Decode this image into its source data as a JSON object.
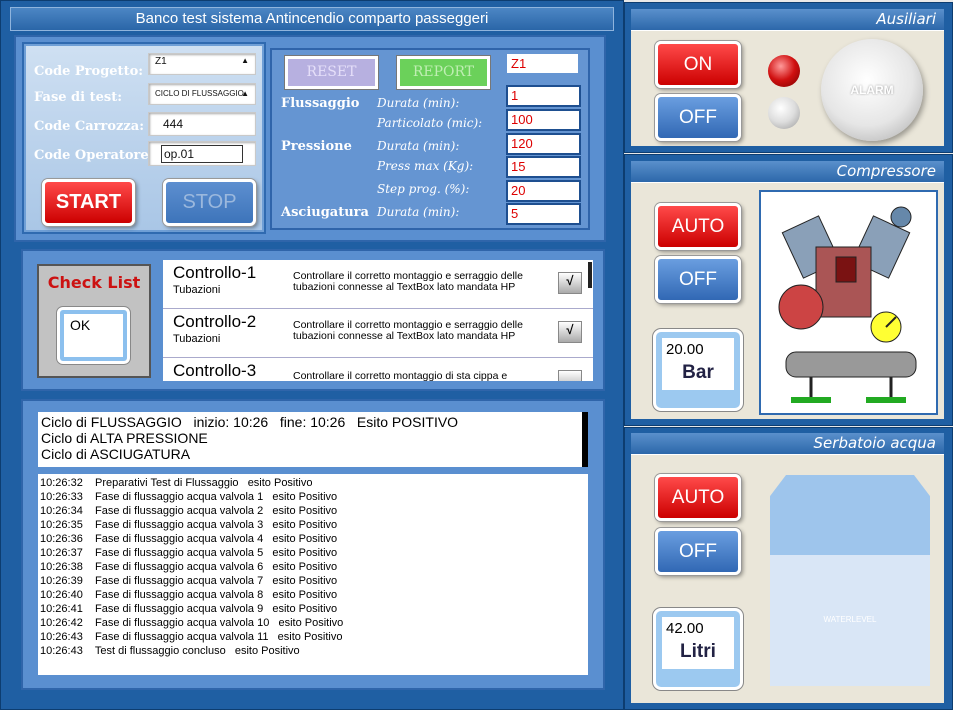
{
  "header": {
    "title": "Banco test sistema Antincendio comparto passeggeri"
  },
  "form": {
    "code_progetto_label": "Code Progetto:",
    "code_progetto_value": "Z1",
    "fase_label": "Fase di test:",
    "fase_value": "CICLO DI FLUSSAGGIO",
    "carrozza_label": "Code Carrozza:",
    "carrozza_value": "444",
    "operatore_label": "Code Operatore:",
    "operatore_value": "op.01",
    "start_label": "START",
    "stop_label": "STOP"
  },
  "params": {
    "reset_label": "RESET",
    "report_label": "REPORT",
    "zone_value": "Z1",
    "flussaggio_label": "Flussaggio",
    "pressione_label": "Pressione",
    "asciugatura_label": "Asciugatura",
    "durata_label": "Durata (min):",
    "particolato_label": "Particolato (mic):",
    "press_max_label": "Press max (Kg):",
    "step_label": "Step prog. (%):",
    "v_fl_durata": "1",
    "v_fl_part": "100",
    "v_pr_durata": "120",
    "v_pr_max": "15",
    "v_pr_step": "20",
    "v_as_durata": "5"
  },
  "checklist": {
    "title": "Check List",
    "ok_label": "OK",
    "items": [
      {
        "title": "Controllo-1",
        "sub": "Tubazioni",
        "desc": "Controllare il corretto montaggio e serraggio delle tubazioni connesse al TextBox lato mandata HP",
        "check": "√"
      },
      {
        "title": "Controllo-2",
        "sub": "Tubazioni",
        "desc": "Controllare il corretto montaggio e serraggio delle tubazioni connesse al TextBox lato mandata HP",
        "check": "√"
      },
      {
        "title": "Controllo-3",
        "sub": "",
        "desc": "Controllare il corretto montaggio di sta cippa e",
        "check": ""
      }
    ]
  },
  "cycles": {
    "line1": "Ciclo di FLUSSAGGIO   inizio: 10:26   fine: 10:26   Esito POSITIVO",
    "line2": "Ciclo di ALTA PRESSIONE",
    "line3": "Ciclo di ASCIUGATURA"
  },
  "log": [
    "10:26:32    Preparativi Test di Flussaggio   esito Positivo",
    "10:26:33    Fase di flussaggio acqua valvola 1   esito Positivo",
    "10:26:34    Fase di flussaggio acqua valvola 2   esito Positivo",
    "10:26:35    Fase di flussaggio acqua valvola 3   esito Positivo",
    "10:26:36    Fase di flussaggio acqua valvola 4   esito Positivo",
    "10:26:37    Fase di flussaggio acqua valvola 5   esito Positivo",
    "10:26:38    Fase di flussaggio acqua valvola 6   esito Positivo",
    "10:26:39    Fase di flussaggio acqua valvola 7   esito Positivo",
    "10:26:40    Fase di flussaggio acqua valvola 8   esito Positivo",
    "10:26:41    Fase di flussaggio acqua valvola 9   esito Positivo",
    "10:26:42    Fase di flussaggio acqua valvola 10   esito Positivo",
    "10:26:43    Fase di flussaggio acqua valvola 11   esito Positivo",
    "10:26:43    Test di flussaggio concluso   esito Positivo"
  ],
  "ausiliari": {
    "title": "Ausiliari",
    "on_label": "ON",
    "off_label": "OFF",
    "alarm_label": "ALARM"
  },
  "compressore": {
    "title": "Compressore",
    "auto_label": "AUTO",
    "off_label": "OFF",
    "value": "20.00",
    "unit": "Bar"
  },
  "serbatoio": {
    "title": "Serbatoio acqua",
    "auto_label": "AUTO",
    "off_label": "OFF",
    "value": "42.00",
    "unit": "Litri",
    "water_label": "WATERLEVEL",
    "water_level": 0.62
  }
}
